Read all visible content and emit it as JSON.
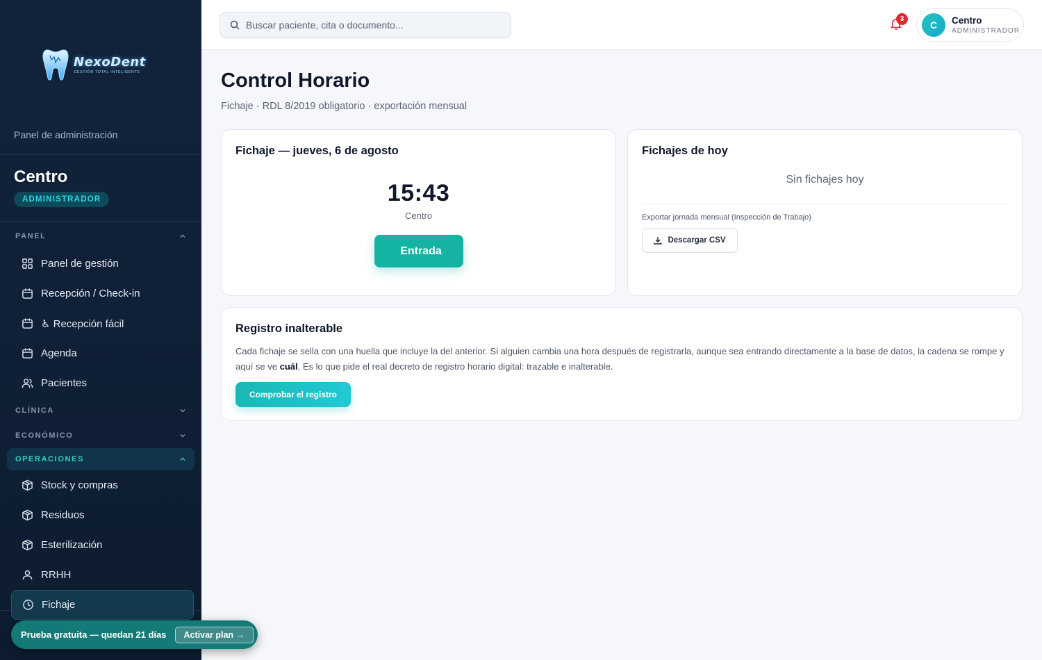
{
  "brand": {
    "name": "NexoDent",
    "tagline": "GESTIÓN TOTAL INTELIGENTE"
  },
  "sidebar": {
    "panel_label": "Panel de administración",
    "center_name": "Centro",
    "role_badge": "ADMINISTRADOR",
    "sections": [
      {
        "label": "PANEL",
        "expanded": true,
        "items": [
          {
            "label": "Panel de gestión",
            "icon": "grid-icon"
          },
          {
            "label": "Recepción / Check-in",
            "icon": "calendar-icon"
          },
          {
            "label": "♿ Recepción fácil",
            "icon": "calendar-icon"
          },
          {
            "label": "Agenda",
            "icon": "calendar-icon"
          },
          {
            "label": "Pacientes",
            "icon": "users-icon"
          }
        ]
      },
      {
        "label": "CLÍNICA",
        "expanded": false
      },
      {
        "label": "ECONÓMICO",
        "expanded": false
      },
      {
        "label": "OPERACIONES",
        "expanded": true,
        "active": true,
        "items": [
          {
            "label": "Stock y compras",
            "icon": "box-icon"
          },
          {
            "label": "Residuos",
            "icon": "box-icon"
          },
          {
            "label": "Esterilización",
            "icon": "box-icon"
          },
          {
            "label": "RRHH",
            "icon": "user-icon"
          },
          {
            "label": "Fichaje",
            "icon": "clock-icon",
            "selected": true
          }
        ]
      }
    ],
    "trial": {
      "text": "Prueba gratuita — quedan 21 días",
      "button": "Activar plan →"
    }
  },
  "topbar": {
    "search_placeholder": "Buscar paciente, cita o documento...",
    "notifications_count": "3",
    "user": {
      "initial": "C",
      "name": "Centro",
      "role": "ADMINISTRADOR"
    }
  },
  "page": {
    "title": "Control Horario",
    "subtitle": "Fichaje · RDL 8/2019 obligatorio · exportación mensual"
  },
  "clock_card": {
    "title": "Fichaje — jueves, 6 de agosto",
    "time": "15:43",
    "who": "Centro",
    "button_glyph": "",
    "button_label": "Entrada"
  },
  "today_card": {
    "title": "Fichajes de hoy",
    "empty": "Sin fichajes hoy",
    "export_label": "Exportar jornada mensual (Inspección de Trabajo)",
    "csv_button": "Descargar CSV"
  },
  "registry_card": {
    "title": "Registro inalterable",
    "text_before": "Cada fichaje se sella con una huella que incluye la del anterior. Si alguien cambia una hora después de registrarla, aunque sea entrando directamente a la base de datos, la cadena se rompe y aquí se ve ",
    "text_bold": "cuál",
    "text_after": ". Es lo que pide el real decreto de registro horario digital: trazable e inalterable.",
    "button": "Comprobar el registro"
  },
  "colors": {
    "accent": "#15b3a4",
    "sidebar_bg": "#12233b",
    "badge_red": "#e0282e",
    "cyan": "#2ed3e6"
  }
}
